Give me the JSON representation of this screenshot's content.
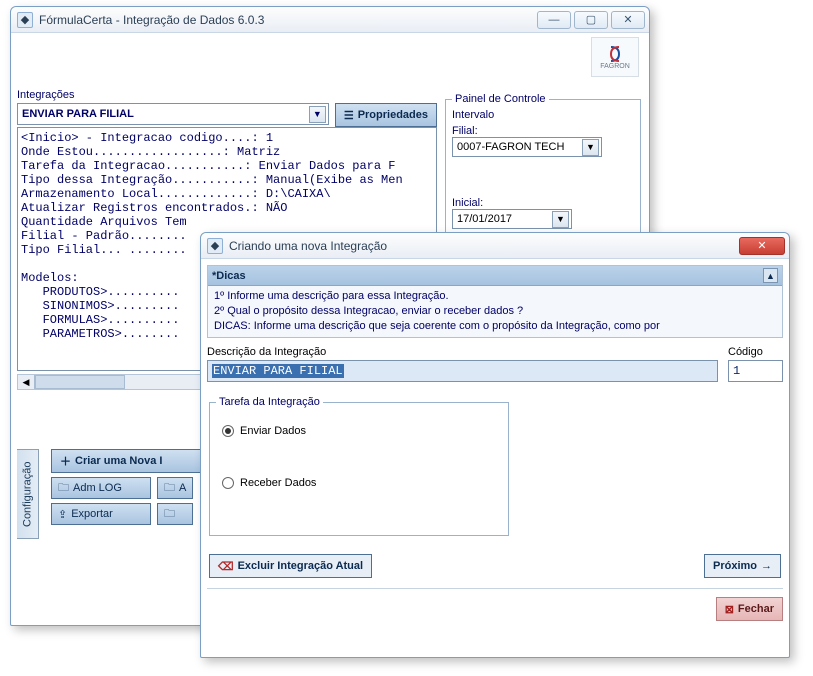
{
  "main": {
    "title": "FórmulaCerta - Integração de Dados 6.0.3",
    "integracoes_label": "Integrações",
    "dropdown_value": "ENVIAR PARA FILIAL",
    "propriedades_label": "Propriedades",
    "log_text": "<Inicio> - Integracao codigo....: 1\nOnde Estou..................: Matriz\nTarefa da Integracao...........: Enviar Dados para F\nTipo dessa Integração...........: Manual(Exibe as Men\nArmazenamento Local.............: D:\\CAIXA\\\nAtualizar Registros encontrados.: NÃO\nQuantidade Arquivos Tem\nFilial - Padrão........\nTipo Filial... ........\n\nModelos:\n   PRODUTOS>..........\n   SINONIMOS>.........\n   FORMULAS>..........\n   PARAMETROS>........",
    "sidebar_tab": "Configuração",
    "buttons": {
      "criar": "Criar uma Nova I",
      "admlog": "Adm LOG",
      "a": "A",
      "exportar": "Exportar"
    },
    "painel": {
      "legend": "Painel de Controle",
      "intervalo": "Intervalo",
      "filial_label": "Filial:",
      "filial_value": "0007-FAGRON TECH",
      "inicial_label": "Inicial:",
      "inicial_value": "17/01/2017"
    },
    "logo_text": "FAGRON"
  },
  "modal": {
    "title": "Criando uma nova Integração",
    "tips_hdr": "*Dicas",
    "tip1": "1º Informe uma descrição para essa Integração.",
    "tip2": "2º Qual o propósito dessa Integracao,  enviar o receber dados ?",
    "tip3": "DICAS: Informe uma descrição que seja coerente com o propósito da Integração, como por",
    "desc_label": "Descrição da Integração",
    "codigo_label": "Código",
    "desc_value": "ENVIAR PARA FILIAL",
    "codigo_value": "1",
    "tarefa_legend": "Tarefa da Integração",
    "radio_enviar": "Enviar Dados",
    "radio_receber": "Receber Dados",
    "excluir": "Excluir Integração Atual",
    "proximo": "Próximo",
    "fechar": "Fechar"
  }
}
